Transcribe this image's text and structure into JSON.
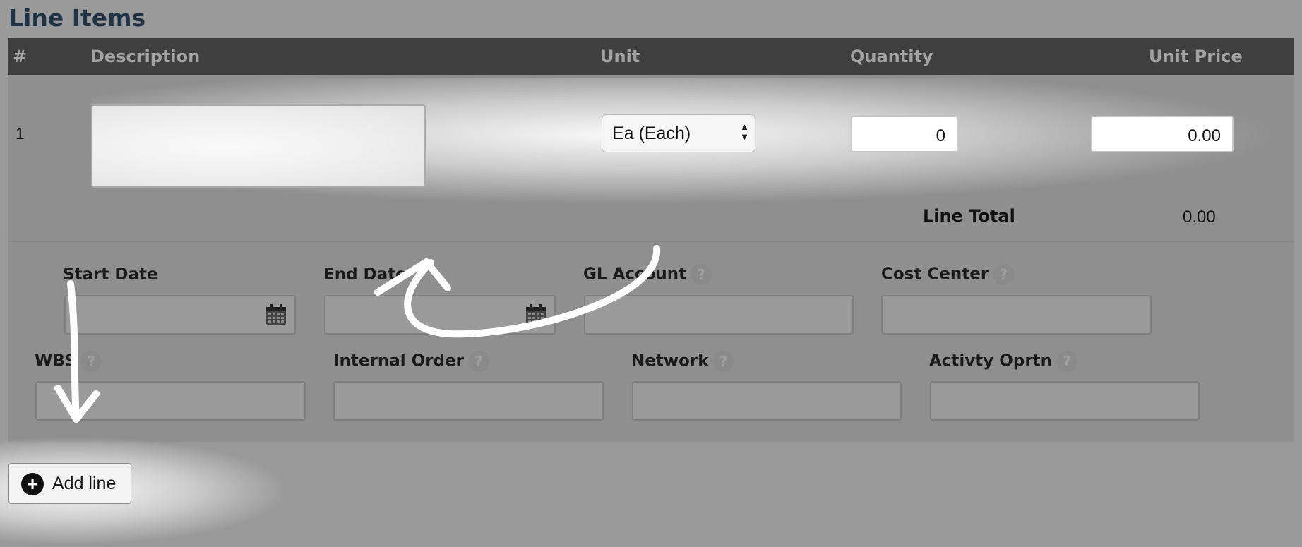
{
  "section": {
    "title": "Line Items"
  },
  "table": {
    "headers": [
      "#",
      "Description",
      "Unit",
      "Quantity",
      "Unit Price"
    ]
  },
  "row": {
    "number": "1",
    "description": "",
    "unit_selected": "Ea (Each)",
    "quantity": "0",
    "unit_price": "0.00",
    "line_total_label": "Line Total",
    "line_total_value": "0.00"
  },
  "fields": {
    "start_date": {
      "label": "Start Date"
    },
    "end_date": {
      "label": "End Date"
    },
    "gl_account": {
      "label": "GL Account"
    },
    "cost_center": {
      "label": "Cost Center"
    },
    "wbs": {
      "label": "WBS"
    },
    "internal_order": {
      "label": "Internal Order"
    },
    "network": {
      "label": "Network"
    },
    "activity_oprtn": {
      "label": "Activty Oprtn"
    }
  },
  "help_glyph": "?",
  "select_arrows": "▲\n▼",
  "add_line": {
    "icon": "plus-circle-icon",
    "icon_glyph": "+",
    "label": "Add line"
  },
  "colors": {
    "header_bg": "#3f3f3f",
    "title": "#1f3346",
    "overlay": "#9a9a9a",
    "highlight": "#ffffff"
  }
}
